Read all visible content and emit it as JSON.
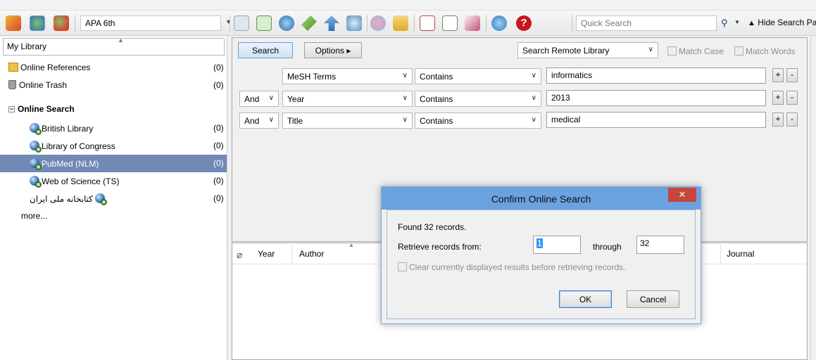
{
  "toolbar": {
    "output_style": "APA 6th",
    "quick_search_placeholder": "Quick Search",
    "hide_pane_label": "Hide Search Pane"
  },
  "library": {
    "header": "My Library",
    "items": [
      {
        "label": "Online References",
        "count": "(0)"
      },
      {
        "label": "Online Trash",
        "count": "(0)"
      }
    ],
    "group_label": "Online Search",
    "sources": [
      {
        "label": "British Library",
        "count": "(0)"
      },
      {
        "label": "Library of Congress",
        "count": "(0)"
      },
      {
        "label": "PubMed (NLM)",
        "count": "(0)"
      },
      {
        "label": "Web of Science (TS)",
        "count": "(0)"
      },
      {
        "label": "کتابخانه ملی ایران",
        "count": "(0)"
      }
    ],
    "more": "more..."
  },
  "search": {
    "search_button": "Search",
    "options_button": "Options ▸",
    "scope": "Search Remote Library",
    "match_case": "Match Case",
    "match_words": "Match Words",
    "rows": [
      {
        "bool": "",
        "field": "MeSH Terms",
        "op": "Contains",
        "value": "informatics"
      },
      {
        "bool": "And",
        "field": "Year",
        "op": "Contains",
        "value": "2013"
      },
      {
        "bool": "And",
        "field": "Title",
        "op": "Contains",
        "value": "medical"
      }
    ]
  },
  "results": {
    "columns": [
      "Year",
      "Author",
      "Journal"
    ]
  },
  "dialog": {
    "title": "Confirm Online Search",
    "found": "Found 32 records.",
    "retrieve_label": "Retrieve records from:",
    "from_value": "1",
    "through_label": "through",
    "to_value": "32",
    "clear_label": "Clear currently displayed results before retrieving records.",
    "ok": "OK",
    "cancel": "Cancel",
    "close": "✕"
  }
}
